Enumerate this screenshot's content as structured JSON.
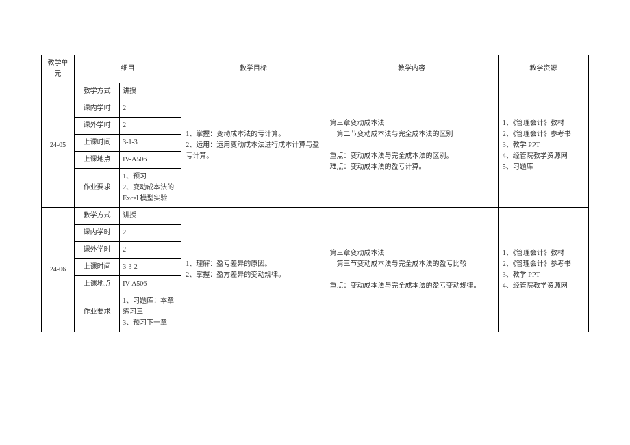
{
  "headers": {
    "unit": "教学单元",
    "detail": "细目",
    "objectives": "教学目标",
    "content": "教学内容",
    "resources": "教学资源"
  },
  "units": [
    {
      "id": "24-05",
      "details": {
        "method_label": "教学方式",
        "method_value": "讲授",
        "inhour_label": "课内学时",
        "inhour_value": "2",
        "outhour_label": "课外学时",
        "outhour_value": "2",
        "time_label": "上课时间",
        "time_value": "3-1-3",
        "place_label": "上课地点",
        "place_value": "IV-A506",
        "hw_label": "作业要求",
        "hw_value": "1、预习\n2、变动成本法的Excel 模型实验"
      },
      "objectives": "1、掌握：变动成本法的亏计算。\n2、运用：运用变动成本法进行成本计算与盈亏计算。",
      "content": "第三章变动成本法\n    第二节变动成本法与完全成本法的区别\n\n重点：变动成本法与完全成本法的区别。\n难点：变动成本法的盈亏计算。",
      "resources": "1、《管理会计》教材\n2、《管理会计》参考书\n3、教学 PPT\n4、经管院教学资源网\n5、习题库"
    },
    {
      "id": "24-06",
      "details": {
        "method_label": "教学方式",
        "method_value": "讲授",
        "inhour_label": "课内学时",
        "inhour_value": "2",
        "outhour_label": "课外学时",
        "outhour_value": "2",
        "time_label": "上课时间",
        "time_value": "3-3-2",
        "place_label": "上课地点",
        "place_value": "IV-A506",
        "hw_label": "作业要求",
        "hw_value": "1、习题库：本章练习三\n3、预习下一章"
      },
      "objectives": "1、理解：盈亏差异的原因。\n2、掌握：盈方差异的变动规律。",
      "content": "第三章变动成本法\n    第三节变动成本法与完全成本法的盈亏比较\n\n重点：变动成本法与完全成本法的盈亏变动规律。",
      "resources": "1、《管理会计》教材\n2、《管理会计》参考书\n3、教学 PPT\n4、经管院教学资源网"
    }
  ]
}
